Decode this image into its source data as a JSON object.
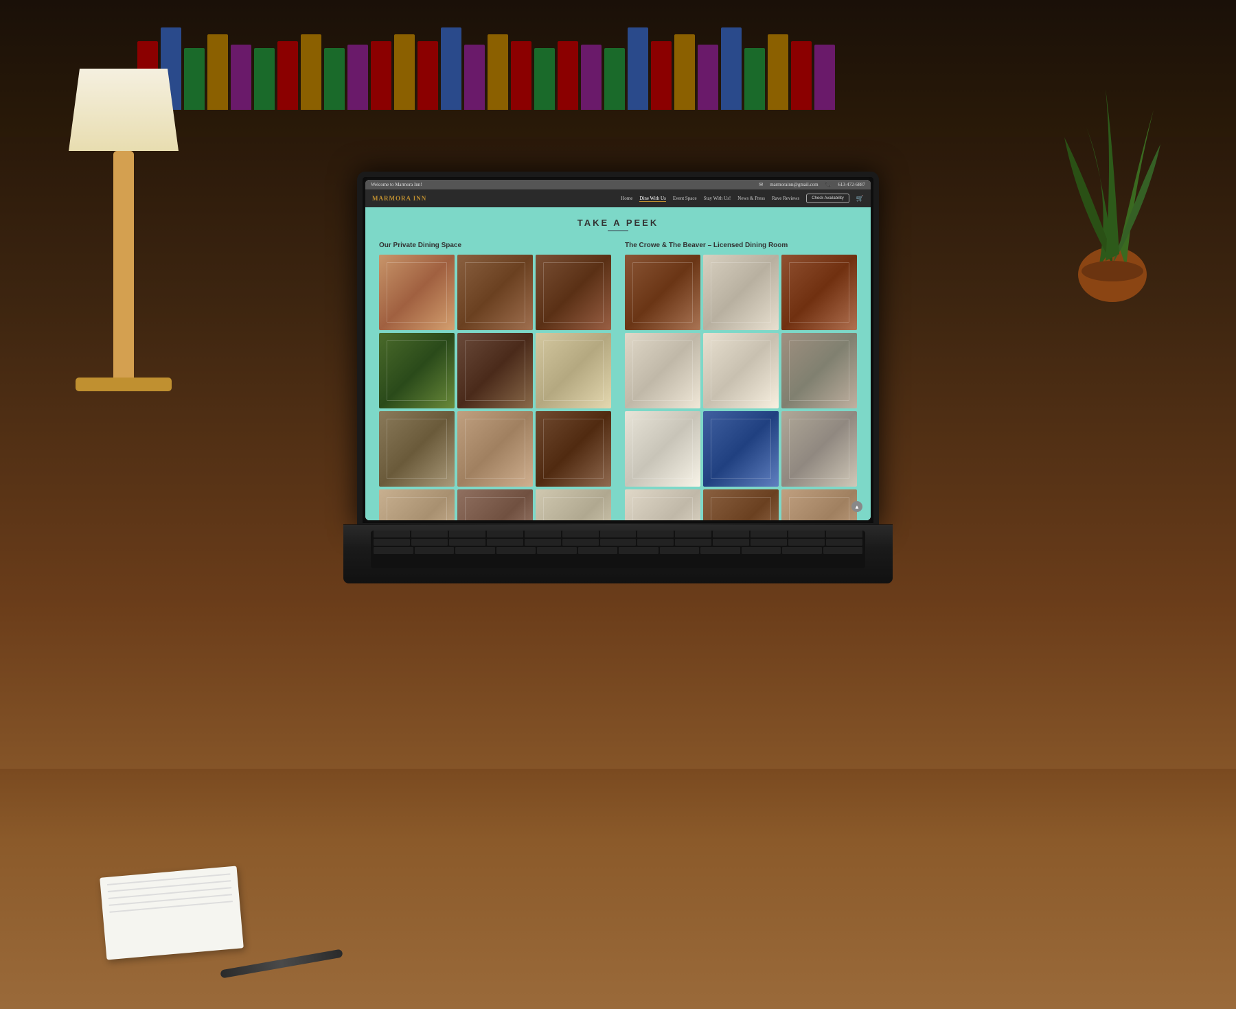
{
  "scene": {
    "background_color": "#2a1a0a"
  },
  "website": {
    "top_bar": {
      "welcome_text": "Welcome to Marmora Inn!",
      "email": "marmorainn@gmail.com",
      "phone": "613-472-6887"
    },
    "nav": {
      "logo": "MARMORA INN",
      "links": [
        {
          "label": "Home",
          "active": false
        },
        {
          "label": "Dine With Us",
          "active": true
        },
        {
          "label": "Event Space",
          "active": false
        },
        {
          "label": "Stay With Us!",
          "active": false
        },
        {
          "label": "News & Press",
          "active": false
        },
        {
          "label": "Rave Reviews",
          "active": false
        }
      ],
      "cta_button": "Check Availability"
    },
    "main": {
      "section_title": "TAKE A PEEK",
      "gallery_left": {
        "title": "Our Private Dining Space",
        "photos": [
          "p1",
          "p2",
          "p3",
          "p4",
          "p5",
          "p6",
          "p7",
          "p8",
          "p9",
          "p10",
          "p11",
          "p12"
        ]
      },
      "gallery_right": {
        "title": "The Crowe & The Beaver – Licensed Dining Room",
        "photos": [
          "r1",
          "r2",
          "r3",
          "r4",
          "r5",
          "r6",
          "r7",
          "r8",
          "r9",
          "r10",
          "r11",
          "r12"
        ]
      }
    }
  }
}
